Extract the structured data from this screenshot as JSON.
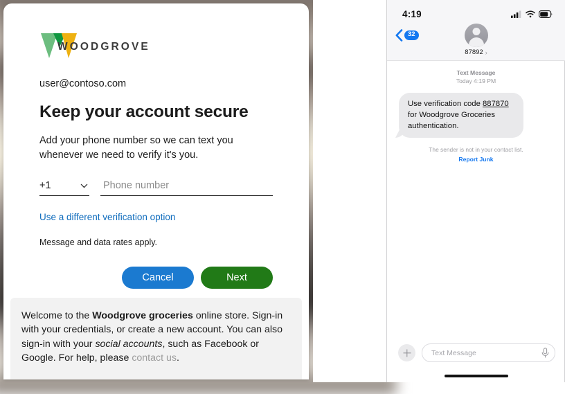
{
  "signin_card": {
    "brand": {
      "logo_icon": "woodgrove-w-logo",
      "wordmark": "WOODGROVE",
      "colors": {
        "light_green": "#6cbd7f",
        "dark_green": "#0f9640",
        "amber": "#eeb111",
        "wordmark_gray": "#3b3b3b"
      }
    },
    "user_email": "user@contoso.com",
    "title": "Keep your account secure",
    "subtitle": "Add your phone number so we can text you whenever we need to verify it's you.",
    "country_code": {
      "value": "+1",
      "chevron_icon": "chevron-down-icon"
    },
    "phone_input": {
      "value": "",
      "placeholder": "Phone number"
    },
    "alt_verification_link": "Use a different verification option",
    "rates_note": "Message and data rates apply.",
    "buttons": {
      "cancel": "Cancel",
      "next": "Next",
      "cancel_color": "#1b7ad0",
      "next_color": "#217a17"
    },
    "footer_banner": {
      "part1": "Welcome to the ",
      "bold1": "Woodgrove groceries",
      "part2": " online store. Sign-in with your credentials, or create a new account. You can also sign-in with your ",
      "italic1": "social accounts",
      "part3": ", such as Facebook or Google. For help, please ",
      "link": "contact us",
      "part4": "."
    }
  },
  "phone": {
    "status_bar": {
      "time": "4:19",
      "signal_icon": "cellular-signal-icon",
      "wifi_icon": "wifi-icon",
      "battery_icon": "battery-icon"
    },
    "nav": {
      "back_icon": "chevron-left-icon",
      "unread_badge": "32",
      "avatar_icon": "person-avatar-icon",
      "contact_name": "87892",
      "detail_arrow": "chevron-right-icon"
    },
    "conversation": {
      "service_label": "Text Message",
      "timestamp": "Today 4:19 PM",
      "message": {
        "before_code": "Use verification code ",
        "code": "887870",
        "after_code": " for Woodgrove Groceries authentication."
      },
      "sender_notice": "The sender is not in your contact list.",
      "report_junk": "Report Junk"
    },
    "composer": {
      "plus_icon": "plus-icon",
      "input_placeholder": "Text Message",
      "mic_icon": "microphone-icon"
    },
    "home_indicator": "home-indicator"
  }
}
